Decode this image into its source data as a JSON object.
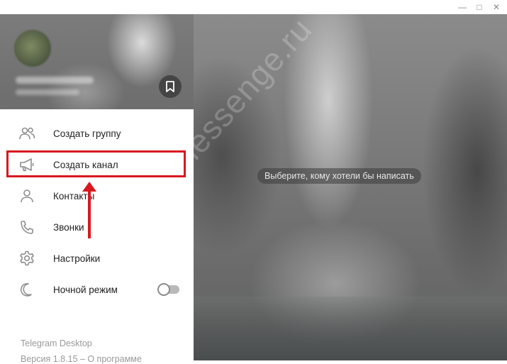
{
  "window": {
    "minimize_glyph": "—",
    "maximize_glyph": "□",
    "close_glyph": "✕"
  },
  "sidebar": {
    "items": [
      {
        "label": "Создать группу",
        "icon": "group-icon"
      },
      {
        "label": "Создать канал",
        "icon": "megaphone-icon"
      },
      {
        "label": "Контакты",
        "icon": "person-icon"
      },
      {
        "label": "Звонки",
        "icon": "phone-icon"
      },
      {
        "label": "Настройки",
        "icon": "gear-icon"
      },
      {
        "label": "Ночной режим",
        "icon": "moon-icon",
        "toggle": false
      }
    ],
    "footer": {
      "app_name": "Telegram Desktop",
      "version_text": "Версия 1.8.15 – О программе"
    }
  },
  "chat": {
    "empty_hint": "Выберите, кому хотели бы написать",
    "watermark": "messenge.ru"
  },
  "annotation": {
    "highlight_color": "#d7191f"
  }
}
